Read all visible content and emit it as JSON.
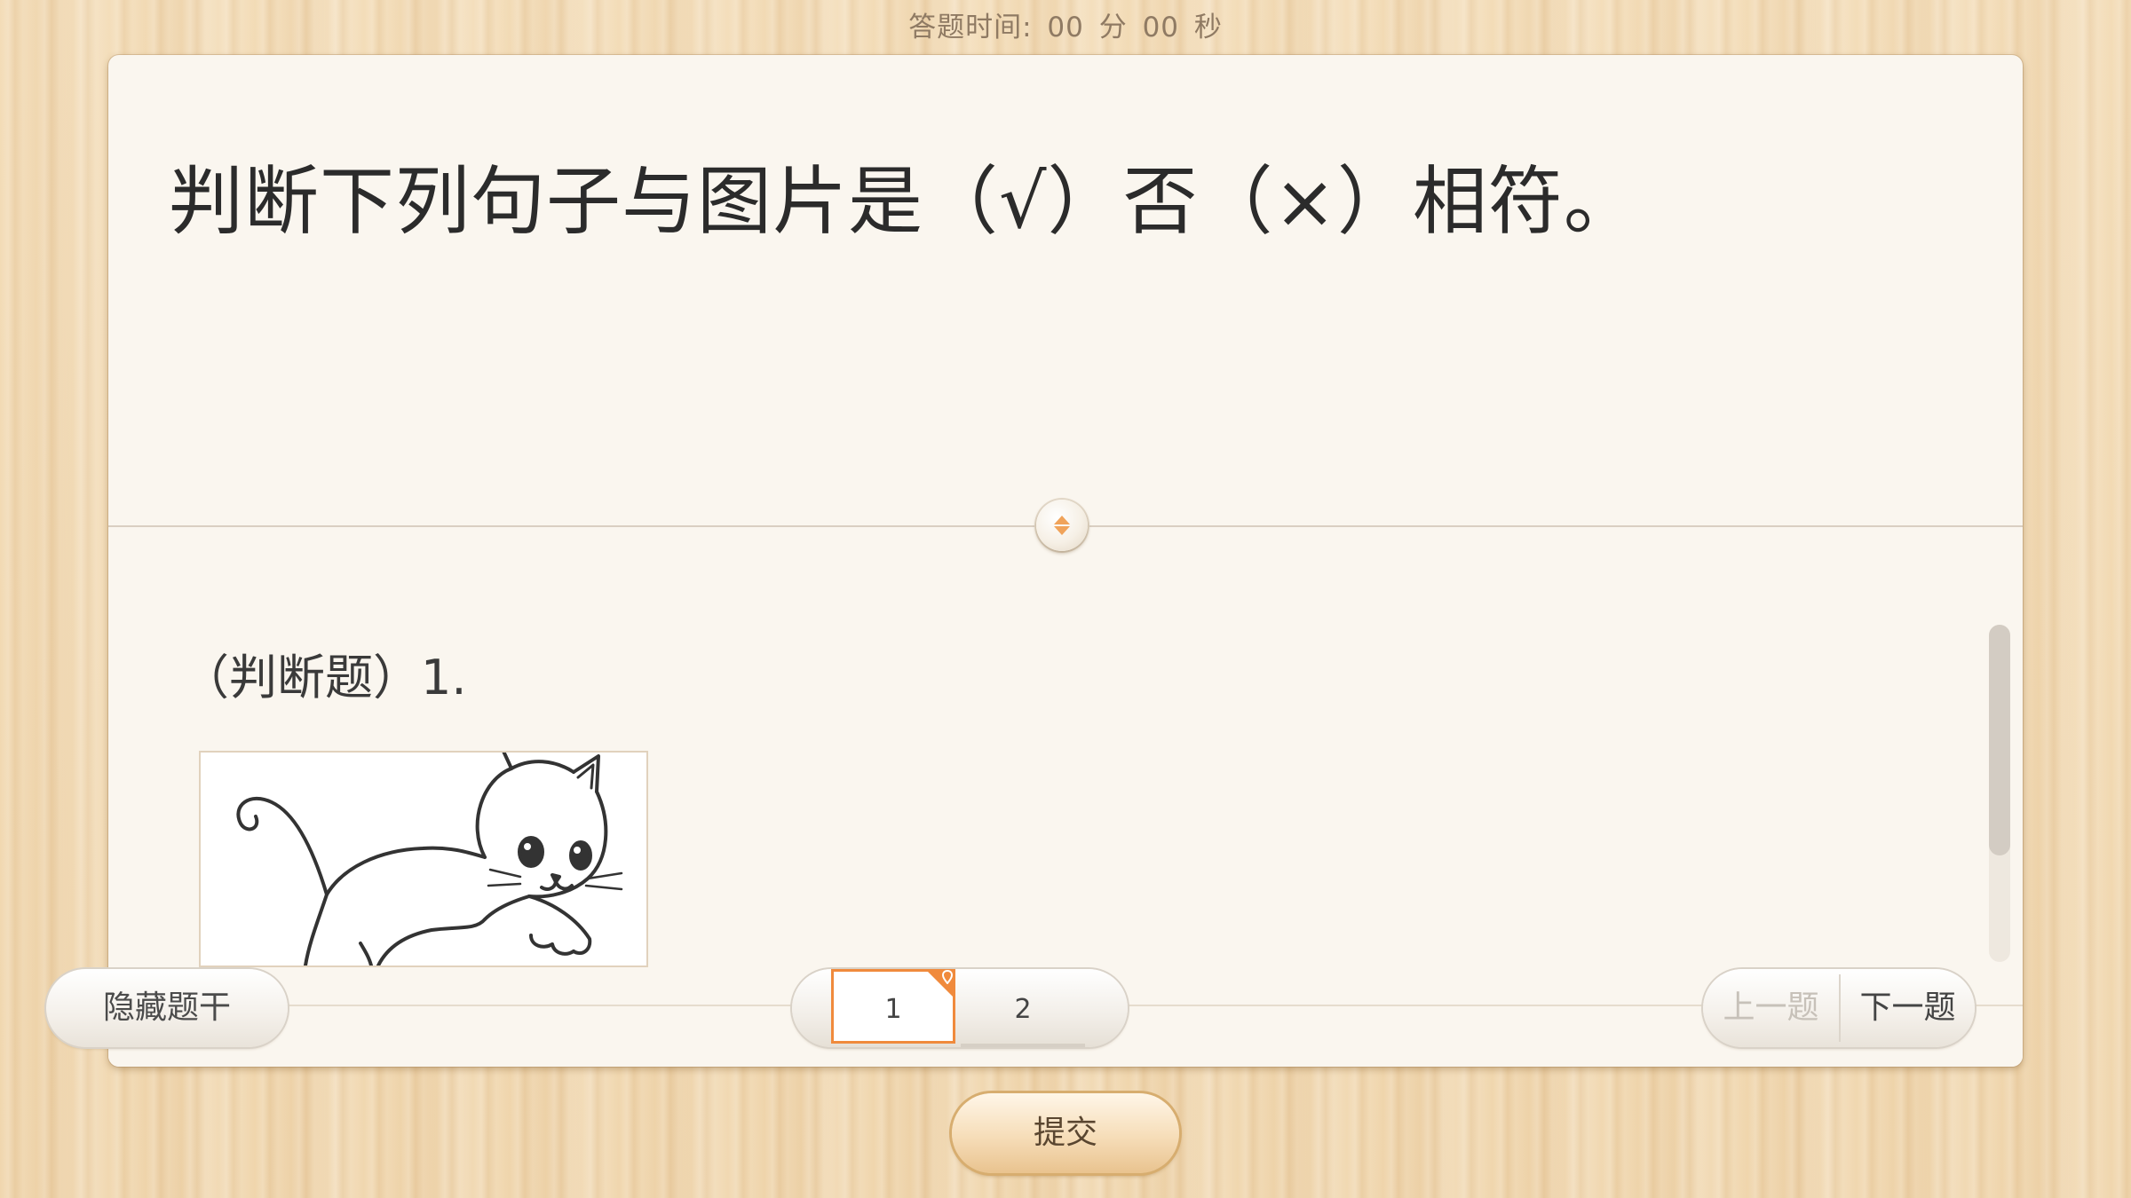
{
  "timer": {
    "label": "答题时间:",
    "minutes": "00",
    "minutes_unit": "分",
    "seconds": "00",
    "seconds_unit": "秒"
  },
  "stem": {
    "text": "判断下列句子与图片是（√）否（×）相符。"
  },
  "question": {
    "label": "（判断题）1.",
    "image": "cat-line-drawing"
  },
  "footer": {
    "hide_stem_label": "隐藏题干",
    "pages": [
      "1",
      "2"
    ],
    "current_page": "1",
    "prev_label": "上一题",
    "next_label": "下一题"
  },
  "submit_label": "提交",
  "colors": {
    "accent": "#f08a3c",
    "card_bg": "#faf6ef",
    "wood_bg": "#f1d8b2"
  }
}
